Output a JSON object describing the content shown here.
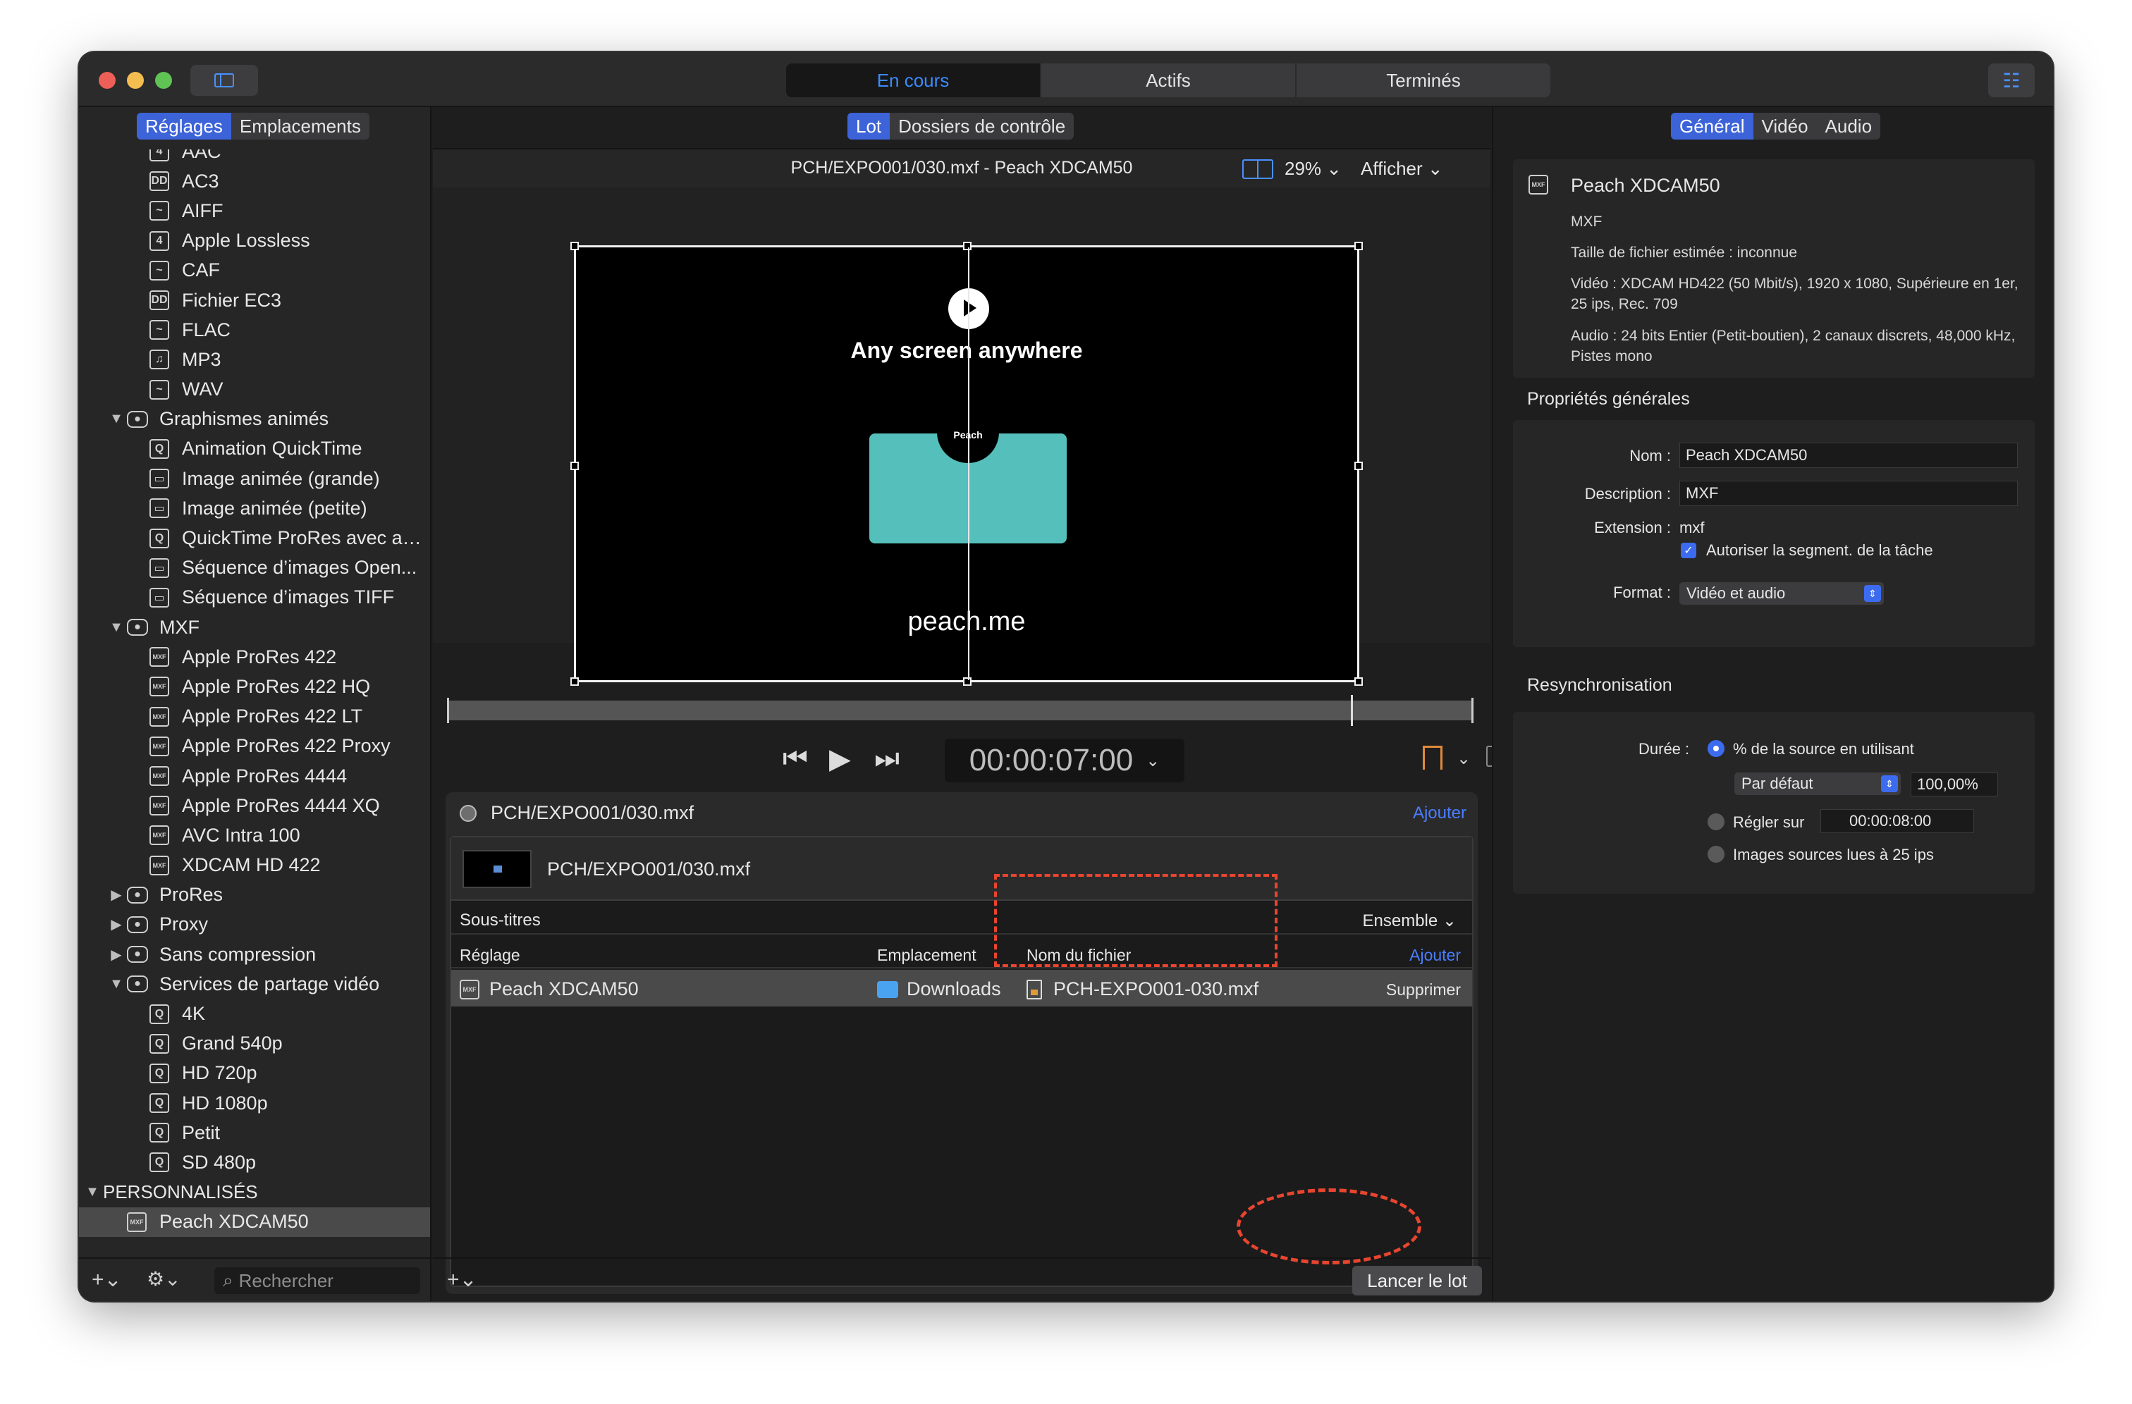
{
  "window": {
    "top_tabs": [
      "En cours",
      "Actifs",
      "Terminés"
    ]
  },
  "left": {
    "tabs": [
      "Réglages",
      "Emplacements"
    ],
    "tree": [
      {
        "kind": "child",
        "icon": "4",
        "label": "AAC"
      },
      {
        "kind": "child",
        "icon": "DD",
        "label": "AC3"
      },
      {
        "kind": "child",
        "icon": "~",
        "label": "AIFF"
      },
      {
        "kind": "child",
        "icon": "4",
        "label": "Apple Lossless"
      },
      {
        "kind": "child",
        "icon": "~",
        "label": "CAF"
      },
      {
        "kind": "child",
        "icon": "DD",
        "label": "Fichier EC3"
      },
      {
        "kind": "child",
        "icon": "~",
        "label": "FLAC"
      },
      {
        "kind": "child",
        "icon": "♫",
        "label": "MP3"
      },
      {
        "kind": "child",
        "icon": "~",
        "label": "WAV"
      },
      {
        "kind": "group",
        "expanded": true,
        "label": "Graphismes animés"
      },
      {
        "kind": "child",
        "icon": "Q",
        "label": "Animation QuickTime"
      },
      {
        "kind": "child",
        "icon": "▭",
        "label": "Image animée (grande)"
      },
      {
        "kind": "child",
        "icon": "▭",
        "label": "Image animée (petite)"
      },
      {
        "kind": "child",
        "icon": "Q",
        "label": "QuickTime ProRes avec al..."
      },
      {
        "kind": "child",
        "icon": "▭",
        "label": "Séquence d’images Open..."
      },
      {
        "kind": "child",
        "icon": "▭",
        "label": "Séquence d’images TIFF"
      },
      {
        "kind": "group",
        "expanded": true,
        "label": "MXF"
      },
      {
        "kind": "child",
        "icon": "MXF",
        "label": "Apple ProRes 422"
      },
      {
        "kind": "child",
        "icon": "MXF",
        "label": "Apple ProRes 422 HQ"
      },
      {
        "kind": "child",
        "icon": "MXF",
        "label": "Apple ProRes 422 LT"
      },
      {
        "kind": "child",
        "icon": "MXF",
        "label": "Apple ProRes 422 Proxy"
      },
      {
        "kind": "child",
        "icon": "MXF",
        "label": "Apple ProRes 4444"
      },
      {
        "kind": "child",
        "icon": "MXF",
        "label": "Apple ProRes 4444 XQ"
      },
      {
        "kind": "child",
        "icon": "MXF",
        "label": "AVC Intra 100"
      },
      {
        "kind": "child",
        "icon": "MXF",
        "label": "XDCAM HD 422"
      },
      {
        "kind": "group",
        "expanded": false,
        "label": "ProRes"
      },
      {
        "kind": "group",
        "expanded": false,
        "label": "Proxy"
      },
      {
        "kind": "group",
        "expanded": false,
        "label": "Sans compression"
      },
      {
        "kind": "group",
        "expanded": true,
        "label": "Services de partage vidéo"
      },
      {
        "kind": "child",
        "icon": "Q",
        "label": "4K"
      },
      {
        "kind": "child",
        "icon": "Q",
        "label": "Grand 540p"
      },
      {
        "kind": "child",
        "icon": "Q",
        "label": "HD 720p"
      },
      {
        "kind": "child",
        "icon": "Q",
        "label": "HD 1080p"
      },
      {
        "kind": "child",
        "icon": "Q",
        "label": "Petit"
      },
      {
        "kind": "child",
        "icon": "Q",
        "label": "SD 480p"
      },
      {
        "kind": "root",
        "expanded": true,
        "label": "PERSONNALISÉS"
      },
      {
        "kind": "group-item",
        "icon": "MXF",
        "label": "Peach XDCAM50",
        "selected": true
      }
    ],
    "search_placeholder": "Rechercher",
    "plus": "+⌄",
    "gear": "⚙⌄"
  },
  "center": {
    "tabs": [
      "Lot",
      "Dossiers de contrôle"
    ],
    "preview_title": "PCH/EXPO001/030.mxf - Peach XDCAM50",
    "zoom": "29% ⌄",
    "show_menu": "Afficher ⌄",
    "video": {
      "headline": "Any screen  anywhere",
      "badge": "Peach",
      "footer": "peach.me"
    },
    "timecode": "00:00:07:00",
    "batch_title": "PCH/EXPO001/030.mxf",
    "batch_add": "Ajouter",
    "job_title": "PCH/EXPO001/030.mxf",
    "subtitles_label": "Sous-titres",
    "subtitles_value": "Ensemble ⌄",
    "columns": {
      "setting": "Réglage",
      "location": "Emplacement",
      "filename": "Nom du fichier",
      "add": "Ajouter"
    },
    "output_row": {
      "setting": "Peach XDCAM50",
      "location": "Downloads",
      "filename": "PCH-EXPO001-030.mxf",
      "delete": "Supprimer"
    },
    "bottom_plus": "+⌄",
    "launch_button": "Lancer le lot"
  },
  "right": {
    "tabs": [
      "Général",
      "Vidéo",
      "Audio"
    ],
    "summary": {
      "name": "Peach XDCAM50",
      "format": "MXF",
      "size": "Taille de fichier estimée : inconnue",
      "video": "Vidéo : XDCAM HD422 (50 Mbit/s), 1920 x 1080, Supérieure en 1er, 25 ips, Rec. 709",
      "audio": "Audio : 24 bits Entier (Petit-boutien), 2 canaux discrets, 48,000 kHz, Pistes mono"
    },
    "general_title": "Propriétés générales",
    "props": {
      "name_label": "Nom :",
      "name_value": "Peach XDCAM50",
      "desc_label": "Description :",
      "desc_value": "MXF",
      "ext_label": "Extension :",
      "ext_value": "mxf",
      "segment_label": "Autoriser la segment. de la tâche",
      "format_label": "Format :",
      "format_value": "Vidéo et audio"
    },
    "resync_title": "Resynchronisation",
    "resync": {
      "duration_label": "Durée :",
      "opt_percent": "% de la source en utilisant",
      "default_popup": "Par défaut",
      "percent_value": "100,00%",
      "opt_set": "Régler sur",
      "set_value": "00:00:08:00",
      "opt_frames": "Images sources lues à 25 ips"
    }
  }
}
